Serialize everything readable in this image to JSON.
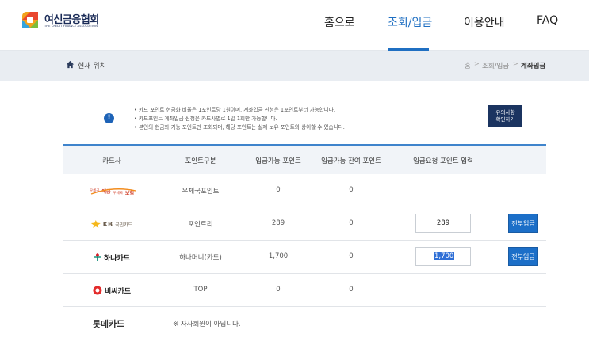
{
  "header": {
    "logo_text": "여신금융협회",
    "logo_sub": "THE CREDIT FINANCE ASSOCIATION",
    "nav": [
      {
        "label": "홈으로"
      },
      {
        "label": "조회/입금"
      },
      {
        "label": "이용안내"
      },
      {
        "label": "FAQ"
      }
    ]
  },
  "location": {
    "label": "현재 위치",
    "crumbs": [
      "홈",
      "조회/입금",
      "계좌입금"
    ]
  },
  "notice": {
    "lines": [
      "• 카드 포인트 현금화 비율은 1포인트당 1원이며, 계좌입금 신청은 1포인트부터 가능합니다.",
      "• 카드포인트 계좌입금 신청은 카드사별로 1일 1회만 가능합니다.",
      "• 본인의 현금화 가능 포인트만 조회되며, 해당 포인트는 실제 보유 포인트와 상이할 수 있습니다."
    ],
    "button_line1": "유의사항",
    "button_line2": "확인하기"
  },
  "table": {
    "headers": [
      "카드사",
      "포인트구분",
      "입금가능 포인트",
      "입금가능 잔여 포인트",
      "입금요청 포인트 입력"
    ],
    "rows": [
      {
        "card": "우체국예금 우체국보험",
        "card_a": "우체국",
        "card_b": "예금",
        "card_c": "우체국",
        "card_d": "보험",
        "type": "우체국포인트",
        "available": "0",
        "remaining": "0"
      },
      {
        "card": "KB국민카드",
        "card_a": "KB",
        "card_b": "국민카드",
        "type": "포인트리",
        "available": "289",
        "remaining": "0",
        "input": "289",
        "button": "전부입금"
      },
      {
        "card": "하나카드",
        "type": "하나머니(카드)",
        "available": "1,700",
        "remaining": "0",
        "input": "1,700",
        "button": "전부입금"
      },
      {
        "card": "비씨카드",
        "type": "TOP",
        "available": "0",
        "remaining": "0"
      },
      {
        "card": "롯데카드",
        "note": "※ 자사회원이 아닙니다."
      }
    ]
  },
  "colors": {
    "brand_navy": "#1a2b57",
    "accent_blue": "#1f6fc2",
    "button_blue": "#1c6fc8",
    "notice_button": "#1b3460"
  }
}
